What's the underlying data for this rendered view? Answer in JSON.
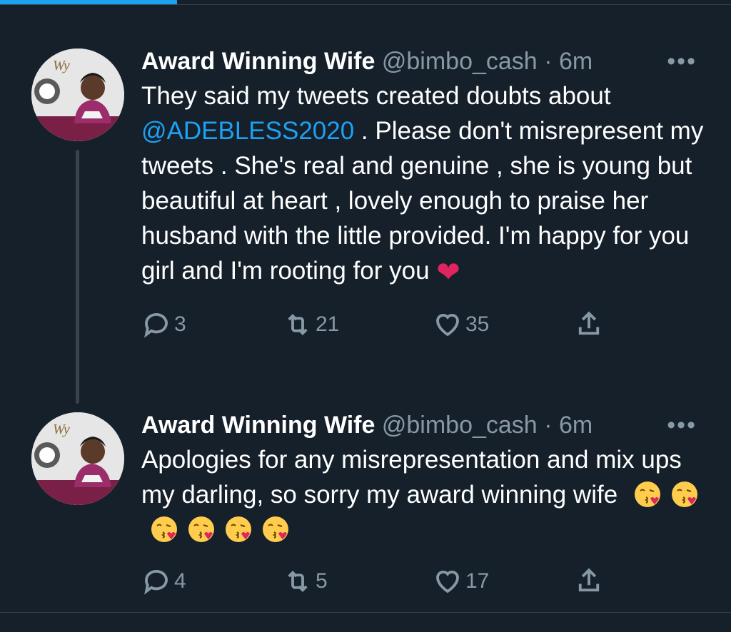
{
  "colors": {
    "background": "#15202b",
    "text": "#ffffff",
    "secondary": "#8899a6",
    "accent": "#1da1f2",
    "heart": "#e0245e",
    "border": "#38444d"
  },
  "tweets": [
    {
      "name": "Award Winning Wife",
      "handle": "@bimbo_cash",
      "separator": "·",
      "time": "6m",
      "more_icon": "more-horizontal-icon",
      "text_pre": "They said my tweets created doubts about ",
      "mention": "@ADEBLESS2020",
      "text_post": " . Please don't misrepresent my tweets . She's real and genuine , she is young but beautiful at heart , lovely enough to praise her husband with the little provided. I'm happy for you girl and I'm rooting for you ",
      "emoji": "❤",
      "reply_count": "3",
      "retweet_count": "21",
      "like_count": "35"
    },
    {
      "name": "Award Winning Wife",
      "handle": "@bimbo_cash",
      "separator": "·",
      "time": "6m",
      "more_icon": "more-horizontal-icon",
      "text": "Apologies for any misrepresentation and mix ups my darling, so sorry my award winning wife ",
      "emoji_name": "face-blowing-a-kiss-emoji",
      "emoji_count": 6,
      "reply_count": "4",
      "retweet_count": "5",
      "like_count": "17"
    }
  ]
}
